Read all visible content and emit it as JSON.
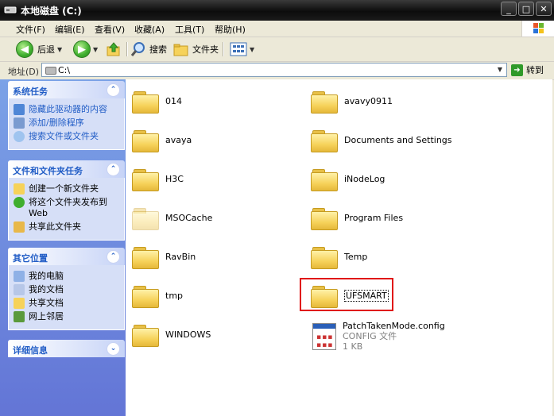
{
  "window": {
    "title": "本地磁盘 (C:)"
  },
  "menu": [
    "文件(F)",
    "编辑(E)",
    "查看(V)",
    "收藏(A)",
    "工具(T)",
    "帮助(H)"
  ],
  "toolbar": {
    "back": "后退",
    "search": "搜索",
    "folders": "文件夹"
  },
  "address": {
    "label": "地址(D)",
    "value": "C:\\",
    "go": "转到"
  },
  "sidebar": {
    "system_tasks": {
      "title": "系统任务",
      "items": [
        "隐藏此驱动器的内容",
        "添加/删除程序",
        "搜索文件或文件夹"
      ]
    },
    "file_tasks": {
      "title": "文件和文件夹任务",
      "items": [
        "创建一个新文件夹",
        "将这个文件夹发布到 Web",
        "共享此文件夹"
      ]
    },
    "other_places": {
      "title": "其它位置",
      "items": [
        "我的电脑",
        "我的文档",
        "共享文档",
        "网上邻居"
      ]
    },
    "details": {
      "title": "详细信息"
    }
  },
  "files": {
    "left": [
      "014",
      "avaya",
      "H3C",
      "MSOCache",
      "RavBin",
      "tmp",
      "WINDOWS"
    ],
    "right": [
      "avavy0911",
      "Documents and Settings",
      "iNodeLog",
      "Program Files",
      "Temp",
      "UFSMART"
    ],
    "config": {
      "name": "PatchTakenMode.config",
      "type": "CONFIG 文件",
      "size": "1 KB"
    }
  }
}
